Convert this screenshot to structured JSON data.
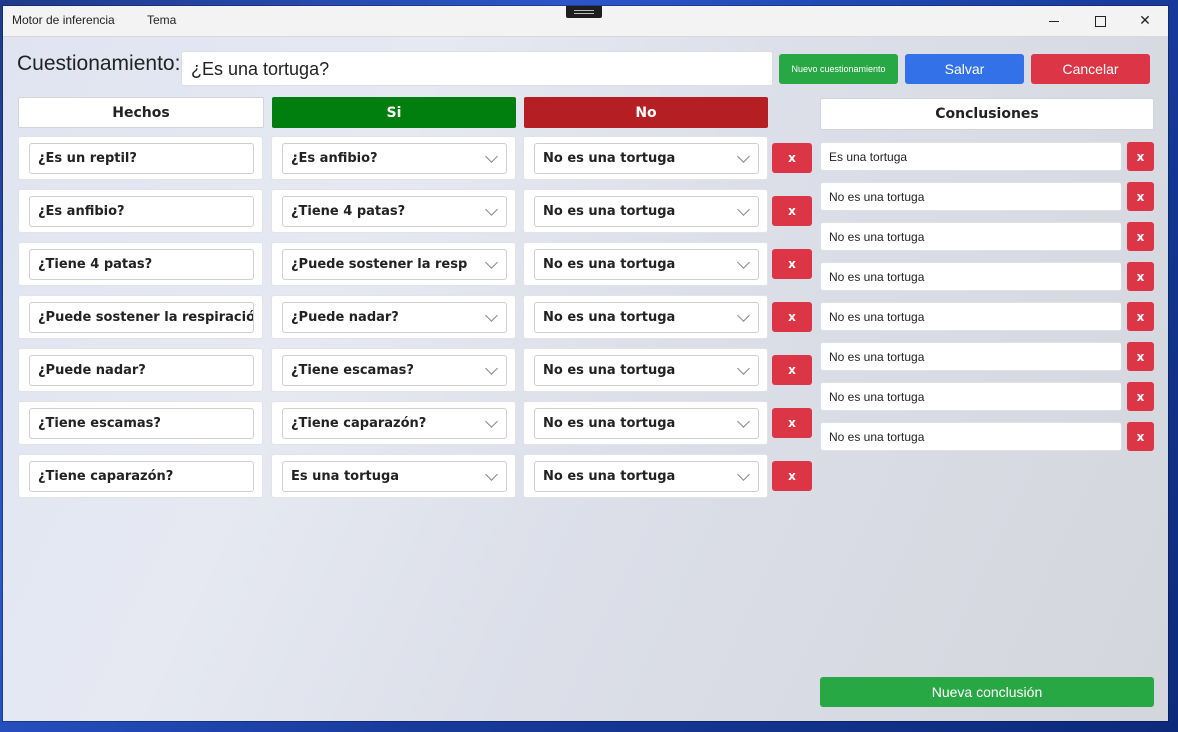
{
  "titlebar": {
    "menu": [
      "Motor de inferencia",
      "Tema"
    ],
    "minimize": "",
    "maximize": "",
    "close": "✕"
  },
  "question": {
    "label": "Cuestionamiento:",
    "value": "¿Es una tortuga?"
  },
  "buttons": {
    "new_question": "Nuevo cuestionamiento",
    "save": "Salvar",
    "cancel": "Cancelar",
    "new_conclusion": "Nueva conclusión"
  },
  "columns": {
    "facts": "Hechos",
    "yes": "Si",
    "no": "No",
    "conclusions": "Conclusiones"
  },
  "rules": [
    {
      "fact": "¿Es un reptil?",
      "yes": "¿Es anfibio?",
      "no": "No es una tortuga",
      "delete": "x"
    },
    {
      "fact": "¿Es anfibio?",
      "yes": "¿Tiene 4 patas?",
      "no": "No es una tortuga",
      "delete": "x"
    },
    {
      "fact": "¿Tiene 4 patas?",
      "yes": "¿Puede sostener la respirac",
      "no": "No es una tortuga",
      "delete": "x"
    },
    {
      "fact": "¿Puede sostener la respiración p",
      "yes": "¿Puede nadar?",
      "no": "No es una tortuga",
      "delete": "x"
    },
    {
      "fact": "¿Puede nadar?",
      "yes": "¿Tiene escamas?",
      "no": "No es una tortuga",
      "delete": "x"
    },
    {
      "fact": "¿Tiene escamas?",
      "yes": "¿Tiene caparazón?",
      "no": "No es una tortuga",
      "delete": "x"
    },
    {
      "fact": "¿Tiene caparazón?",
      "yes": "Es una tortuga",
      "no": "No es una tortuga",
      "delete": "x"
    }
  ],
  "conclusions": [
    {
      "text": "Es una tortuga",
      "delete": "x"
    },
    {
      "text": "No es una tortuga",
      "delete": "x"
    },
    {
      "text": "No es una tortuga",
      "delete": "x"
    },
    {
      "text": "No es una tortuga",
      "delete": "x"
    },
    {
      "text": "No es una tortuga",
      "delete": "x"
    },
    {
      "text": "No es una tortuga",
      "delete": "x"
    },
    {
      "text": "No es una tortuga",
      "delete": "x"
    },
    {
      "text": "No es una tortuga",
      "delete": "x"
    }
  ],
  "colors": {
    "green": "#28a745",
    "blue": "#3271e8",
    "red": "#dc3545",
    "yes_header": "#007e0e",
    "no_header": "#b51f23"
  }
}
